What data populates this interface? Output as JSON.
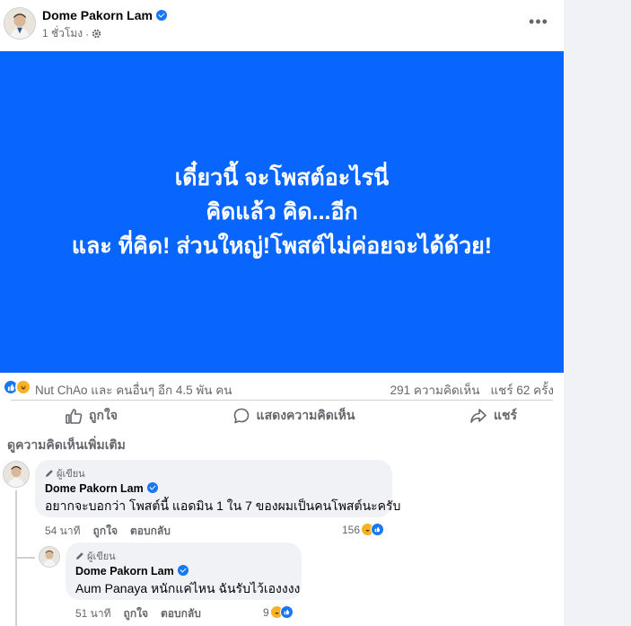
{
  "post": {
    "author": "Dome Pakorn Lam",
    "time": "1 ชั่วโมง",
    "separator": "·",
    "banner_lines": [
      "เดี๋ยวนี้ จะโพสต์อะไรนี่",
      "คิดแล้ว คิด...อีก",
      "และ ที่คิด! ส่วนใหญ่!โพสต์ไม่ค่อยจะได้ด้วย!"
    ],
    "banner_color": "#0866ff",
    "reactions_text": "Nut ChAo และ คนอื่นๆ อีก 4.5 พัน คน",
    "comments_count": "291 ความคิดเห็น",
    "shares_count": "แชร์ 62 ครั้ง",
    "actions": {
      "like": "ถูกใจ",
      "comment": "แสดงความคิดเห็น",
      "share": "แชร์"
    },
    "more_comments": "ดูความคิดเห็นเพิ่มเติม"
  },
  "comments": [
    {
      "badge": "ผู้เขียน",
      "author": "Dome Pakorn Lam",
      "text": "อยากจะบอกว่า โพสต์นี้ แอดมิน 1 ใน 7 ของผมเป็นคนโพสต์นะครับ",
      "time": "54 นาที",
      "like": "ถูกใจ",
      "reply": "ตอบกลับ",
      "reactions": "156"
    },
    {
      "badge": "ผู้เขียน",
      "author": "Dome Pakorn Lam",
      "text": "Aum Panaya หนักแค่ไหน ฉันรับไว้เองงงง",
      "time": "51 นาที",
      "like": "ถูกใจ",
      "reply": "ตอบกลับ",
      "reactions": "9"
    }
  ],
  "colors": {
    "accent": "#1877f2",
    "secondary_text": "#65676b",
    "bubble": "#f0f2f5"
  }
}
